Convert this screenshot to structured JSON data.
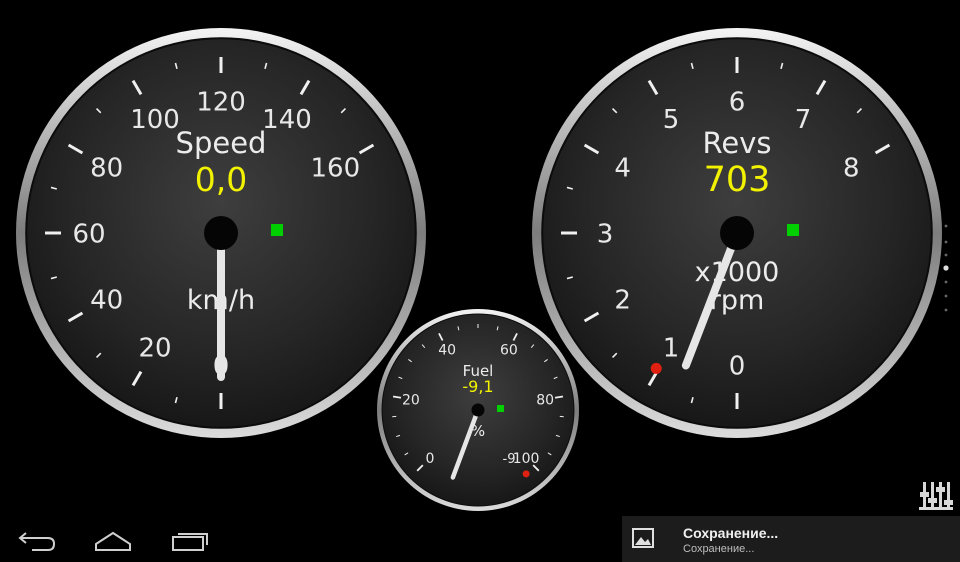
{
  "speed": {
    "title": "Speed",
    "value": "0,0",
    "unit": "km/h",
    "ticks": [
      "0",
      "20",
      "40",
      "60",
      "80",
      "100",
      "120",
      "140",
      "160"
    ],
    "needle_value": 0,
    "indicator_color": "#00d000"
  },
  "revs": {
    "title": "Revs",
    "value": "703",
    "unit_line1": "x1000",
    "unit_line2": "rpm",
    "ticks": [
      "0",
      "1",
      "2",
      "3",
      "4",
      "5",
      "6",
      "7",
      "8"
    ],
    "needle_value": 0.703,
    "indicator_color": "#00d000"
  },
  "fuel": {
    "title": "Fuel",
    "value": "-9,1",
    "unit": "%",
    "ticks": [
      "0",
      "20",
      "40",
      "60",
      "80",
      "100"
    ],
    "end_label": "-9",
    "needle_value": -9.1,
    "indicator_color": "#00d000"
  },
  "notification": {
    "title": "Сохранение...",
    "subtitle": "Сохранение..."
  },
  "icons": {
    "back": "back-arrow-icon",
    "home": "home-icon",
    "recents": "recent-apps-icon",
    "notification": "image-icon",
    "settings": "equalizer-settings-icon"
  },
  "colors": {
    "value": "#f2f200",
    "indicator": "#00d000",
    "warning": "#e02010"
  }
}
